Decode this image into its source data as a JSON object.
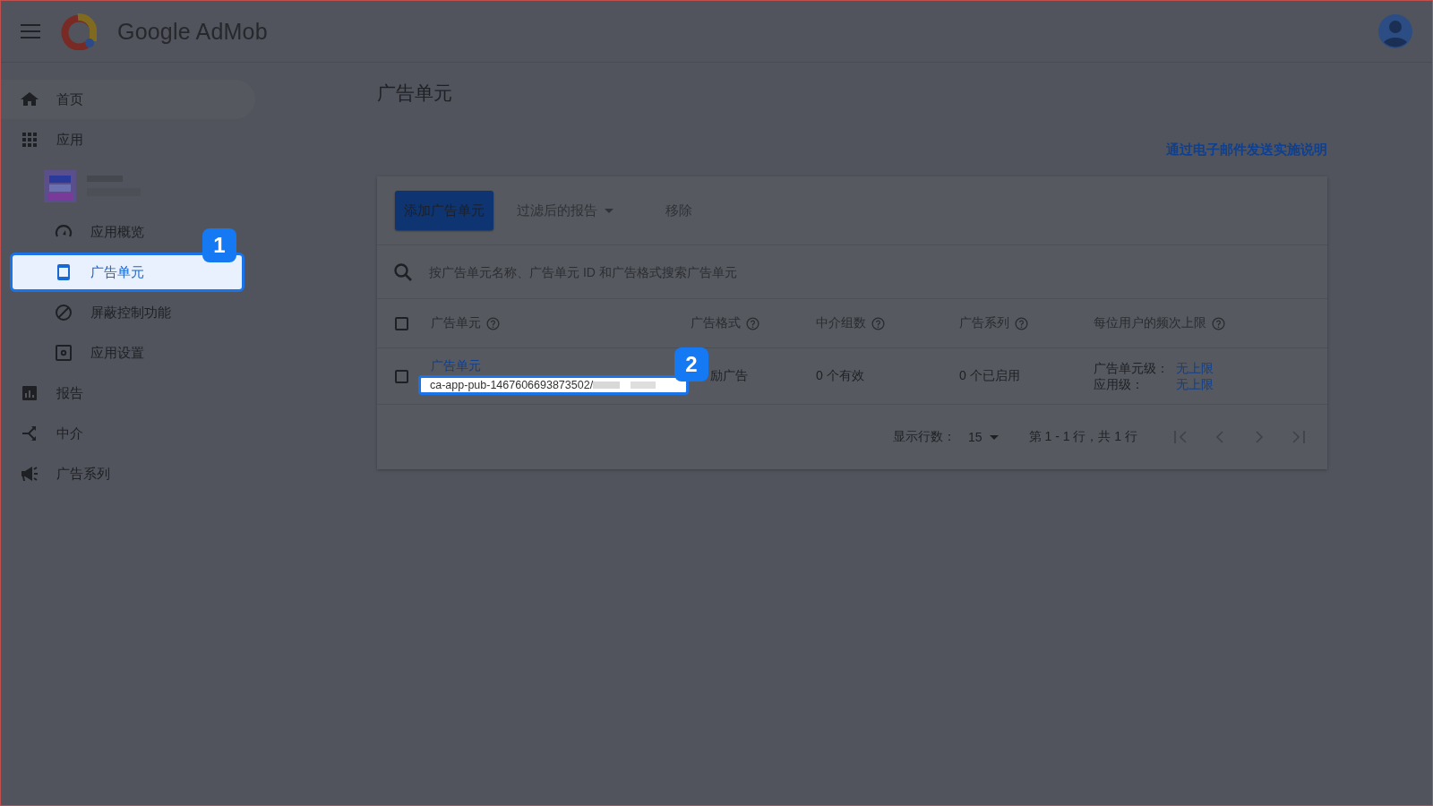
{
  "header": {
    "product": "Google AdMob"
  },
  "sidebar": {
    "items": [
      {
        "label": "首页",
        "hovered": true,
        "selected": false
      },
      {
        "label": "应用",
        "hovered": false,
        "selected": false,
        "children": [
          {
            "kind": "picture",
            "children": [
              {
                "label": "应用概览",
                "hovered": false,
                "selected": false
              },
              {
                "label": "广告单元",
                "hovered": false,
                "selected": true,
                "callout": "1"
              },
              {
                "label": "屏蔽控制功能",
                "hovered": false,
                "selected": false
              },
              {
                "label": "应用设置",
                "hovered": false,
                "selected": false
              }
            ]
          }
        ]
      },
      {
        "label": "报告",
        "hovered": false,
        "selected": false
      },
      {
        "label": "中介",
        "hovered": false,
        "selected": false
      },
      {
        "label": "广告系列",
        "hovered": false,
        "selected": false
      }
    ]
  },
  "page": {
    "title": "广告单元",
    "email_link": "通过电子邮件发送实施说明"
  },
  "toolbar": [
    {
      "label": "添加广告单元",
      "kind": "primary",
      "disabled": false
    },
    {
      "label": "过滤后的报告",
      "kind": "dropdown",
      "disabled": true
    },
    {
      "label": "移除",
      "kind": "text",
      "disabled": true
    }
  ],
  "search": {
    "placeholder": "按广告单元名称、广告单元 ID 和广告格式搜索广告单元"
  },
  "table": {
    "all_checked": false,
    "columns": [
      {
        "label": "广告单元",
        "help": true
      },
      {
        "label": "广告格式",
        "help": true
      },
      {
        "label": "中介组数",
        "help": true
      },
      {
        "label": "广告系列",
        "help": true
      },
      {
        "label": "每位用户的频次上限",
        "help": true
      }
    ],
    "rows": [
      {
        "checked": false,
        "name": "广告单元",
        "id": "ca-app-pub-1467606693873502/",
        "id_callout": "2",
        "format": "励广告",
        "mediation": "0 个有效",
        "campaigns": "0 个已启用",
        "caps": [
          {
            "label": "广告单元级：",
            "value": "无上限"
          },
          {
            "label": "应用级：",
            "value": "无上限"
          }
        ]
      }
    ]
  },
  "pagination": {
    "rows_label": "显示行数：",
    "rows_value": "15",
    "range": "第 1 - 1 行，共 1 行"
  }
}
